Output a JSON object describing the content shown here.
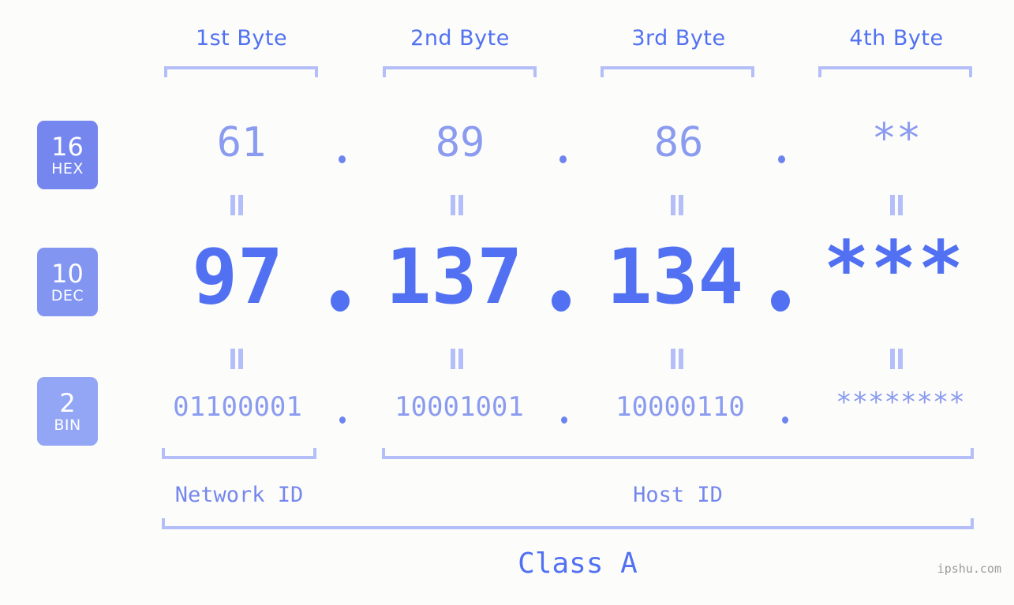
{
  "background_color": "#fcfdfa",
  "accent_color": "#5271f2",
  "muted_accent_color": "#8a9bf0",
  "bracket_color": "#b4bef8",
  "byte_headers": [
    {
      "label": "1st Byte"
    },
    {
      "label": "2nd Byte"
    },
    {
      "label": "3rd Byte"
    },
    {
      "label": "4th Byte"
    }
  ],
  "radix_badges": [
    {
      "number": "16",
      "system": "HEX",
      "color": "#7587ee"
    },
    {
      "number": "10",
      "system": "DEC",
      "color": "#8295f1"
    },
    {
      "number": "2",
      "system": "BIN",
      "color": "#93a6f5"
    }
  ],
  "rows": {
    "hex": {
      "radix": "16",
      "system": "HEX",
      "octets": [
        "61",
        "89",
        "86",
        "**"
      ],
      "separator": "."
    },
    "dec": {
      "radix": "10",
      "system": "DEC",
      "octets": [
        "97",
        "137",
        "134",
        "***"
      ],
      "separator": "."
    },
    "bin": {
      "radix": "2",
      "system": "BIN",
      "octets": [
        "01100001",
        "10001001",
        "10000110",
        "********"
      ],
      "separator": "."
    }
  },
  "equality_symbol": "||",
  "id_sections": [
    {
      "label": "Network ID"
    },
    {
      "label": "Host ID"
    }
  ],
  "class_label": "Class A",
  "watermark": "ipshu.com"
}
